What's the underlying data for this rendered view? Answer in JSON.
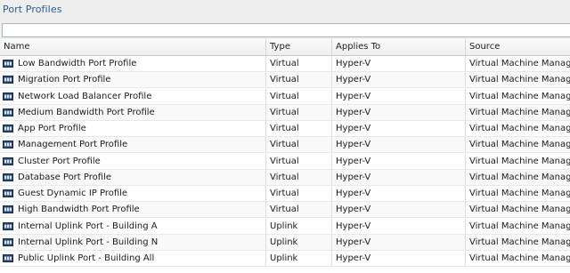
{
  "panel": {
    "title": "Port Profiles",
    "filter_placeholder": ""
  },
  "columns": [
    "Name",
    "Type",
    "Applies To",
    "Source"
  ],
  "rows": [
    {
      "name": "Low Bandwidth Port Profile",
      "type": "Virtual",
      "applies_to": "Hyper-V",
      "source": "Virtual Machine Manager",
      "icon": "port-profile-icon"
    },
    {
      "name": "Migration Port Profile",
      "type": "Virtual",
      "applies_to": "Hyper-V",
      "source": "Virtual Machine Manager",
      "icon": "port-profile-icon"
    },
    {
      "name": "Network Load Balancer Profile",
      "type": "Virtual",
      "applies_to": "Hyper-V",
      "source": "Virtual Machine Manager",
      "icon": "port-profile-icon"
    },
    {
      "name": "Medium Bandwidth Port Profile",
      "type": "Virtual",
      "applies_to": "Hyper-V",
      "source": "Virtual Machine Manager",
      "icon": "port-profile-icon"
    },
    {
      "name": "App Port Profile",
      "type": "Virtual",
      "applies_to": "Hyper-V",
      "source": "Virtual Machine Manager",
      "icon": "port-profile-icon"
    },
    {
      "name": "Management Port Profile",
      "type": "Virtual",
      "applies_to": "Hyper-V",
      "source": "Virtual Machine Manager",
      "icon": "port-profile-icon"
    },
    {
      "name": "Cluster Port Profile",
      "type": "Virtual",
      "applies_to": "Hyper-V",
      "source": "Virtual Machine Manager",
      "icon": "port-profile-icon"
    },
    {
      "name": "Database Port Profile",
      "type": "Virtual",
      "applies_to": "Hyper-V",
      "source": "Virtual Machine Manager",
      "icon": "port-profile-icon"
    },
    {
      "name": "Guest Dynamic IP Profile",
      "type": "Virtual",
      "applies_to": "Hyper-V",
      "source": "Virtual Machine Manager",
      "icon": "port-profile-icon"
    },
    {
      "name": "High Bandwidth Port Profile",
      "type": "Virtual",
      "applies_to": "Hyper-V",
      "source": "Virtual Machine Manager",
      "icon": "port-profile-icon"
    },
    {
      "name": "Internal Uplink Port - Building A",
      "type": "Uplink",
      "applies_to": "Hyper-V",
      "source": "Virtual Machine Manager",
      "icon": "port-profile-icon"
    },
    {
      "name": "Internal Uplink Port - Building N",
      "type": "Uplink",
      "applies_to": "Hyper-V",
      "source": "Virtual Machine Manager",
      "icon": "port-profile-icon"
    },
    {
      "name": "Public Uplink Port - Building All",
      "type": "Uplink",
      "applies_to": "Hyper-V",
      "source": "Virtual Machine Manager",
      "icon": "port-profile-icon"
    }
  ]
}
